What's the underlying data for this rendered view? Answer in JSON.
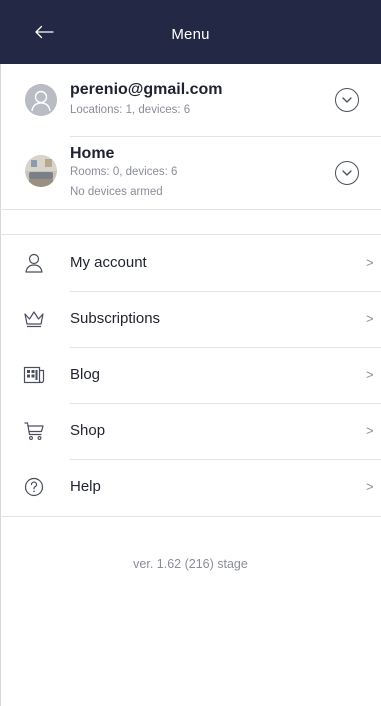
{
  "header": {
    "title": "Menu"
  },
  "accounts": [
    {
      "title": "perenio@gmail.com",
      "line1": "Locations: 1, devices: 6",
      "line2": ""
    },
    {
      "title": "Home",
      "line1": "Rooms: 0, devices: 6",
      "line2": "No devices armed"
    }
  ],
  "menu": {
    "items": [
      {
        "label": "My account",
        "icon": "user-icon"
      },
      {
        "label": "Subscriptions",
        "icon": "crown-icon"
      },
      {
        "label": "Blog",
        "icon": "news-icon"
      },
      {
        "label": "Shop",
        "icon": "cart-icon"
      },
      {
        "label": "Help",
        "icon": "help-icon"
      }
    ],
    "arrow": ">"
  },
  "footer": {
    "version": "ver. 1.62 (216) stage"
  },
  "colors": {
    "header_bg": "#232844",
    "text": "#1f2230",
    "muted": "#8a8d99",
    "divider": "#e2e3e7"
  }
}
